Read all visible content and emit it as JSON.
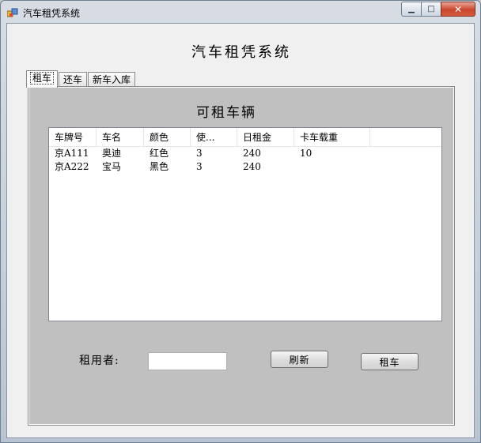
{
  "window": {
    "title": "汽车租凭系统",
    "minimize_glyph": "▁",
    "maximize_glyph": "□",
    "close_glyph": "✕"
  },
  "app": {
    "heading": "汽车租凭系统"
  },
  "tabs": [
    {
      "label": "租车",
      "active": true
    },
    {
      "label": "还车",
      "active": false
    },
    {
      "label": "新车入库",
      "active": false
    }
  ],
  "panel": {
    "title": "可租车辆",
    "columns": [
      "车牌号",
      "车名",
      "颜色",
      "使...",
      "日租金",
      "卡车载重"
    ],
    "rows": [
      [
        "京A111",
        "奥迪",
        "红色",
        "3",
        "240",
        "10"
      ],
      [
        "京A222",
        "宝马",
        "黑色",
        "3",
        "240",
        ""
      ]
    ],
    "renter_label": "租用者:",
    "renter_value": "",
    "refresh_label": "刷新",
    "rent_label": "租车"
  },
  "colors": {
    "panel_bg": "#c0c0c0",
    "client_bg": "#f0f0f0",
    "close_button": "#c9462d"
  }
}
